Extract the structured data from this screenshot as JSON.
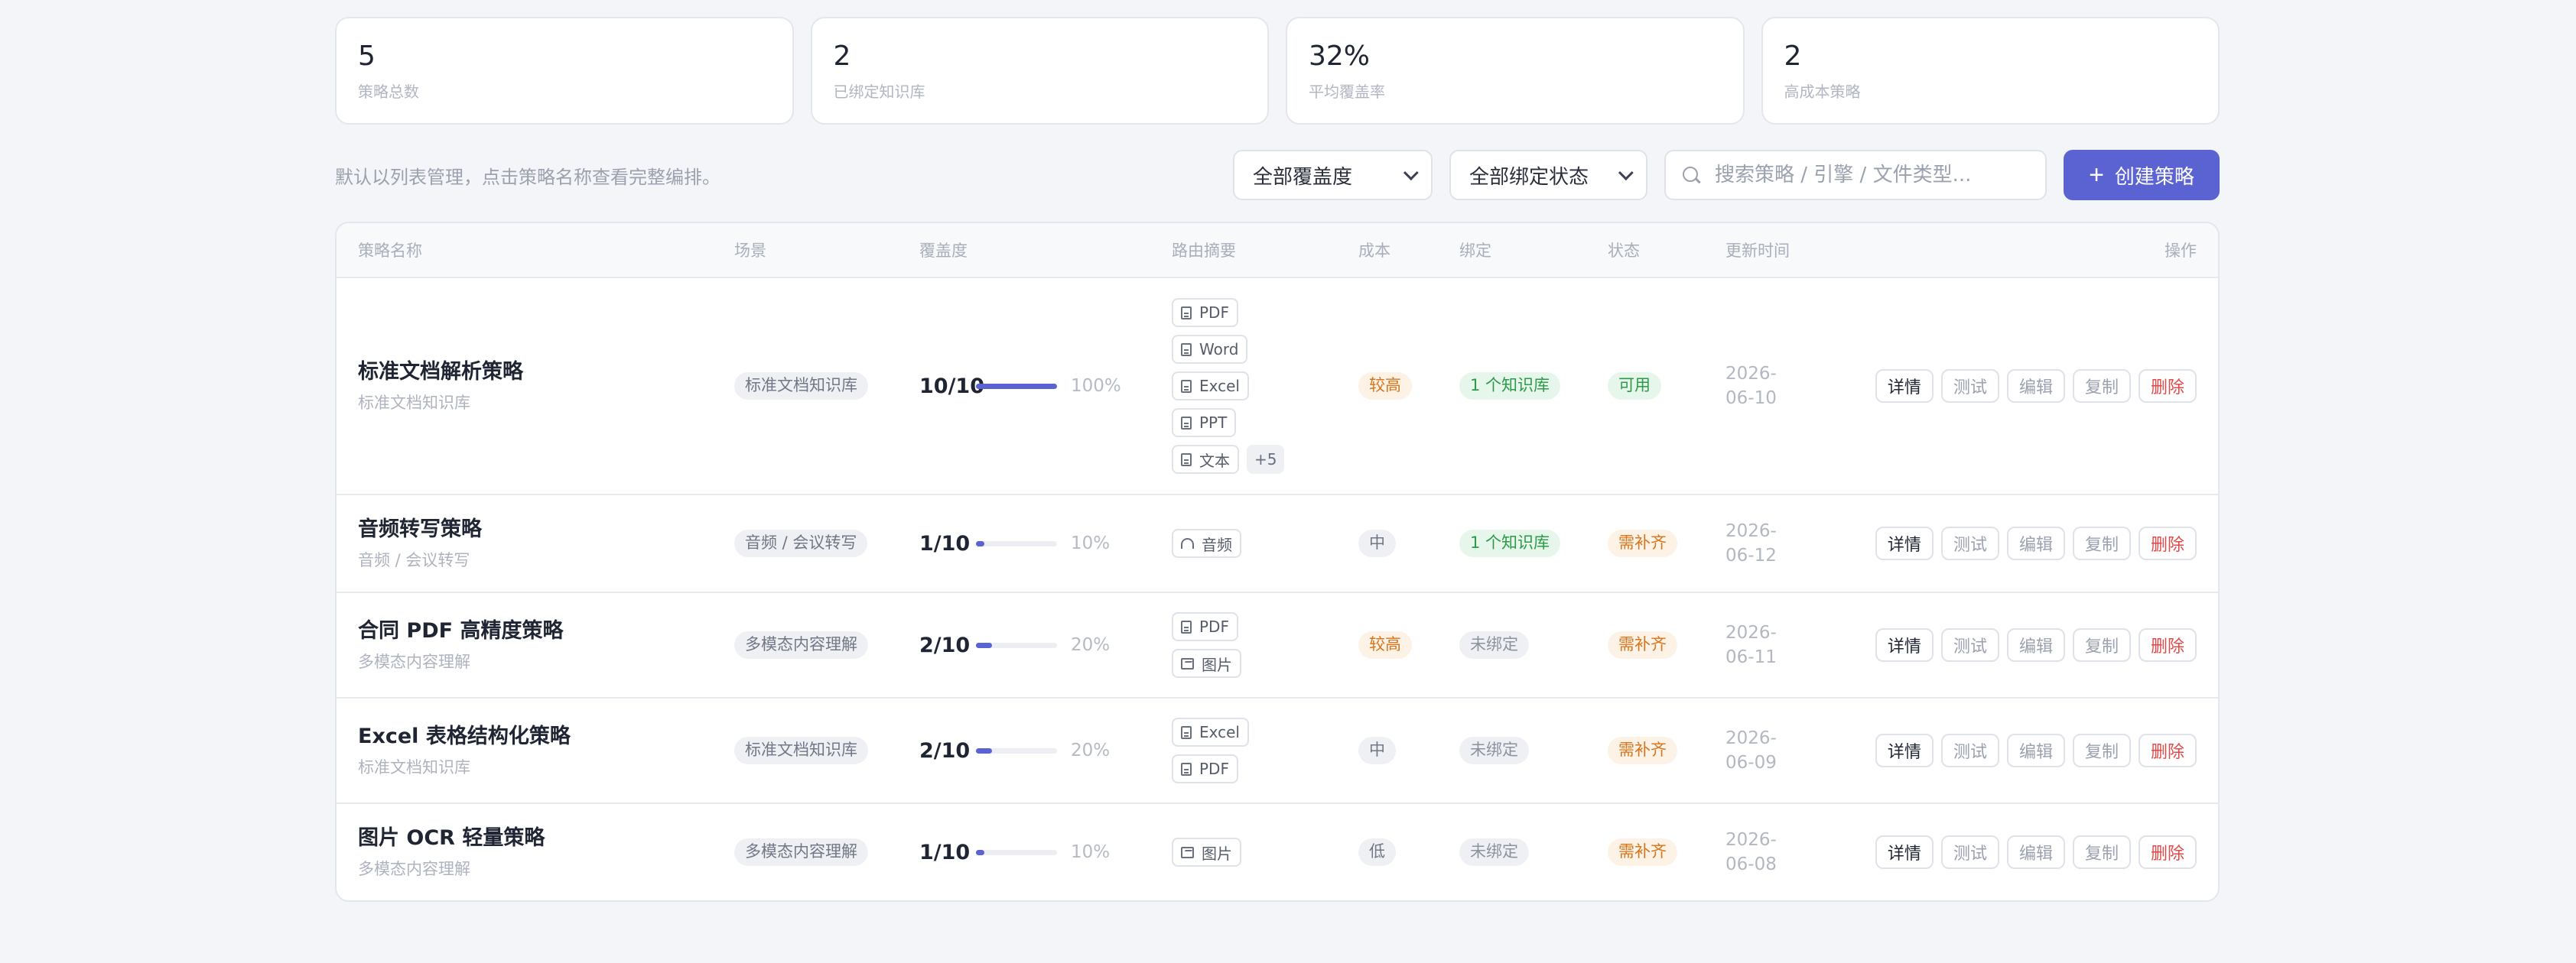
{
  "stats": [
    {
      "value": "5",
      "label": "策略总数"
    },
    {
      "value": "2",
      "label": "已绑定知识库"
    },
    {
      "value": "32%",
      "label": "平均覆盖率"
    },
    {
      "value": "2",
      "label": "高成本策略"
    }
  ],
  "toolbar": {
    "hint": "默认以列表管理，点击策略名称查看完整编排。",
    "coverage_select": "全部覆盖度",
    "binding_select": "全部绑定状态",
    "search_placeholder": "搜索策略 / 引擎 / 文件类型...",
    "create_label": "创建策略",
    "create_icon": "+"
  },
  "table": {
    "headers": {
      "name": "策略名称",
      "scene": "场景",
      "coverage": "覆盖度",
      "route": "路由摘要",
      "cost": "成本",
      "binding": "绑定",
      "status": "状态",
      "updated": "更新时间",
      "ops": "操作"
    },
    "op_labels": {
      "detail": "详情",
      "test": "测试",
      "edit": "编辑",
      "copy": "复制",
      "delete": "删除"
    },
    "rows": [
      {
        "name": "标准文档解析策略",
        "sub": "标准文档知识库",
        "scene": "标准文档知识库",
        "coverage": "10/10",
        "coverage_fraction": 1.0,
        "coverage_pct": "100%",
        "routes": [
          "PDF",
          "Word",
          "Excel",
          "PPT",
          "文本"
        ],
        "more": "+5",
        "cost": "较高",
        "binding": "1 个知识库",
        "status": "可用",
        "date_year": "2026-",
        "date_md": "06-10"
      },
      {
        "name": "音频转写策略",
        "sub": "音频 / 会议转写",
        "scene": "音频 / 会议转写",
        "coverage": "1/10",
        "coverage_fraction": 0.1,
        "coverage_pct": "10%",
        "routes": [
          "音频"
        ],
        "cost": "中",
        "binding": "1 个知识库",
        "status": "需补齐",
        "date_year": "2026-",
        "date_md": "06-12"
      },
      {
        "name": "合同 PDF 高精度策略",
        "sub": "多模态内容理解",
        "scene": "多模态内容理解",
        "coverage": "2/10",
        "coverage_fraction": 0.2,
        "coverage_pct": "20%",
        "routes": [
          "PDF",
          "图片"
        ],
        "cost": "较高",
        "binding": "未绑定",
        "status": "需补齐",
        "date_year": "2026-",
        "date_md": "06-11"
      },
      {
        "name": "Excel 表格结构化策略",
        "sub": "标准文档知识库",
        "scene": "标准文档知识库",
        "coverage": "2/10",
        "coverage_fraction": 0.2,
        "coverage_pct": "20%",
        "routes": [
          "Excel",
          "PDF"
        ],
        "cost": "中",
        "binding": "未绑定",
        "status": "需补齐",
        "date_year": "2026-",
        "date_md": "06-09"
      },
      {
        "name": "图片 OCR 轻量策略",
        "sub": "多模态内容理解",
        "scene": "多模态内容理解",
        "coverage": "1/10",
        "coverage_fraction": 0.1,
        "coverage_pct": "10%",
        "routes": [
          "图片"
        ],
        "cost": "低",
        "binding": "未绑定",
        "status": "需补齐",
        "date_year": "2026-",
        "date_md": "06-08"
      }
    ]
  },
  "colors": {
    "accent": "#5b63d3",
    "ok": "#2c9a49",
    "warn": "#d7741b",
    "danger": "#e04848"
  }
}
